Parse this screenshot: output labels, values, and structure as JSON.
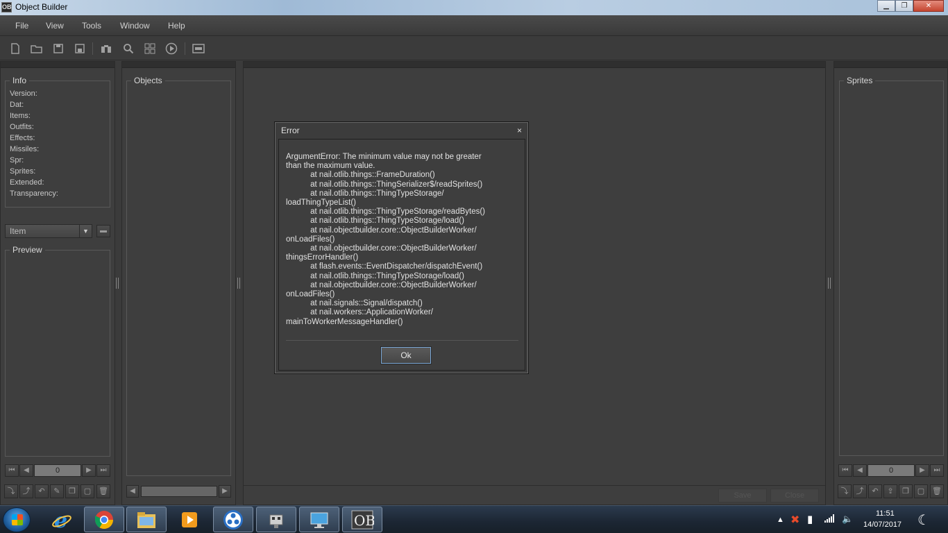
{
  "window": {
    "title": "Object Builder",
    "app_icon": "OB",
    "minimize": "▁",
    "maximize": "❐",
    "close": "✕"
  },
  "menu": [
    "File",
    "View",
    "Tools",
    "Window",
    "Help"
  ],
  "info_panel": {
    "title": "Info",
    "fields": [
      "Version:",
      "Dat:",
      "Items:",
      "Outfits:",
      "Effects:",
      "Missiles:",
      "Spr:",
      "Sprites:",
      "Extended:",
      "Transparency:"
    ],
    "category_select": "Item",
    "preview_title": "Preview",
    "index_value": "0"
  },
  "objects_panel": {
    "title": "Objects"
  },
  "sprites_panel": {
    "title": "Sprites",
    "index_value": "0"
  },
  "editor": {
    "save_label": "Save",
    "close_label": "Close"
  },
  "dialog": {
    "title": "Error",
    "close": "×",
    "message": "ArgumentError: The minimum value may not be greater\nthan the maximum value.\n           at nail.otlib.things::FrameDuration()\n           at nail.otlib.things::ThingSerializer$/readSprites()\n           at nail.otlib.things::ThingTypeStorage/\nloadThingTypeList()\n           at nail.otlib.things::ThingTypeStorage/readBytes()\n           at nail.otlib.things::ThingTypeStorage/load()\n           at nail.objectbuilder.core::ObjectBuilderWorker/\nonLoadFiles()\n           at nail.objectbuilder.core::ObjectBuilderWorker/\nthingsErrorHandler()\n           at flash.events::EventDispatcher/dispatchEvent()\n           at nail.otlib.things::ThingTypeStorage/load()\n           at nail.objectbuilder.core::ObjectBuilderWorker/\nonLoadFiles()\n           at nail.signals::Signal/dispatch()\n           at nail.workers::ApplicationWorker/\nmainToWorkerMessageHandler()",
    "ok_label": "Ok"
  },
  "taskbar": {
    "time": "11:51",
    "date": "14/07/2017",
    "apps": [
      "internet-explorer",
      "chrome",
      "file-explorer",
      "media-player",
      "app-blue-circles",
      "app-robot",
      "app-display",
      "object-builder"
    ]
  }
}
